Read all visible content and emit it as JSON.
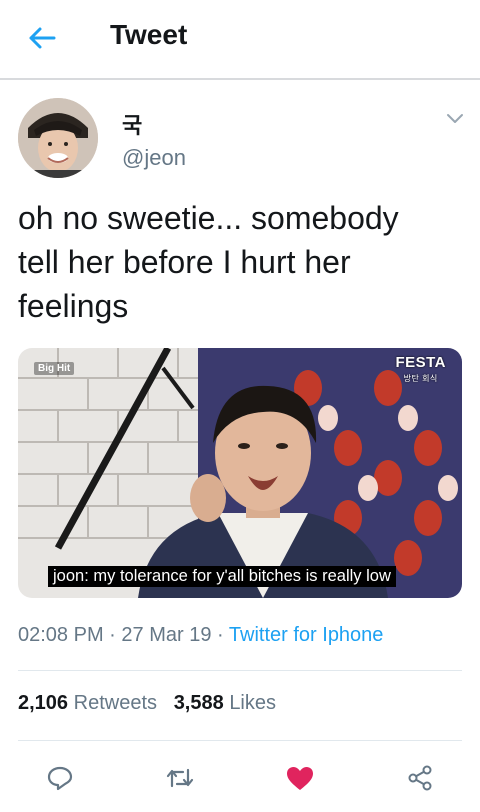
{
  "header": {
    "title": "Tweet",
    "back_icon": "arrow-left-icon",
    "accent_color": "#1da1f2"
  },
  "author": {
    "display_name": "국",
    "handle": "@jeon",
    "avatar_icon": "profile-avatar",
    "menu_icon": "chevron-down-icon"
  },
  "tweet": {
    "text_lines": [
      "oh no sweetie... somebody",
      "tell her before I hurt her",
      "feelings"
    ],
    "media": {
      "caption": "joon: my tolerance for y'all bitches is really low",
      "logo_right": "FESTA",
      "logo_right_sub": "방탄 회식",
      "logo_left": "Big Hit"
    },
    "time": "02:08 PM",
    "date": "27 Mar 19",
    "separator": "·",
    "source": "Twitter for Iphone"
  },
  "stats": {
    "retweets_count": "2,106",
    "retweets_label": "Retweets",
    "likes_count": "3,588",
    "likes_label": "Likes"
  },
  "actions": {
    "reply_icon": "reply-icon",
    "retweet_icon": "retweet-icon",
    "like_icon": "heart-icon",
    "like_color": "#e0245e",
    "share_icon": "share-icon"
  }
}
